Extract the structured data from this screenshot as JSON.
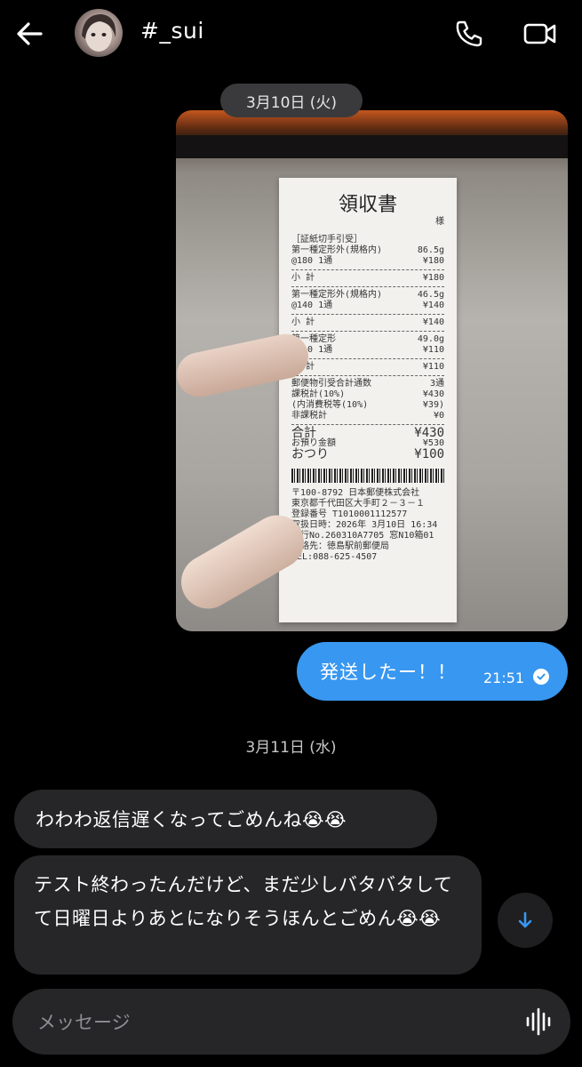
{
  "header": {
    "title": "#_sui",
    "back_icon": "arrow-left-icon",
    "call_icon": "phone-icon",
    "video_icon": "video-camera-icon"
  },
  "messages": {
    "date1": "3月10日 (火)",
    "photo_receipt": {
      "title": "領収書",
      "lines": [
        [
          "様",
          ""
        ],
        [
          "［証紙切手引受］",
          ""
        ],
        [
          "第一種定形外(規格内)",
          "86.5g"
        ],
        [
          "@180 1通",
          "¥180"
        ],
        [
          "小 計",
          "¥180"
        ],
        [
          "第一種定形外(規格内)",
          "46.5g"
        ],
        [
          "@140 1通",
          "¥140"
        ],
        [
          "小 計",
          "¥140"
        ],
        [
          "第一種定形",
          "49.0g"
        ],
        [
          "@110 1通",
          "¥110"
        ],
        [
          "小 計",
          "¥110"
        ],
        [
          "郵便物引受合計通数",
          "3通"
        ],
        [
          "課税計(10%)",
          "¥430"
        ],
        [
          "(内消費税等(10%)",
          "¥39)"
        ],
        [
          "非課税計",
          "¥0"
        ],
        [
          "合計",
          "¥430"
        ],
        [
          "お預り金額",
          "¥530"
        ],
        [
          "おつり",
          "¥100"
        ]
      ],
      "footer": [
        "〒100-8792 日本郵便株式会社",
        "東京都千代田区大手町２－３－１",
        "登録番号 T1010001112577",
        "取扱日時：2026年 3月10日 16:34",
        "発行No.260310A7705 窓N10箱01",
        "連絡先：徳島駅前郵便局",
        "TEL:088-625-4507"
      ]
    },
    "outgoing_text": "発送したー！！",
    "outgoing_time": "21:51",
    "date2": "3月11日 (水)",
    "incoming1": "わわわ返信遅くなってごめんね😭😭",
    "incoming2": "テスト終わったんだけど、まだ少しバタバタしてて日曜日よりあとになりそうほんとごめん😭😭"
  },
  "composer": {
    "placeholder": "メッセージ",
    "voice_icon": "voice-waveform-icon"
  },
  "colors": {
    "background": "#000000",
    "outgoing_bubble": "#3897f0",
    "incoming_bubble": "#262628"
  }
}
